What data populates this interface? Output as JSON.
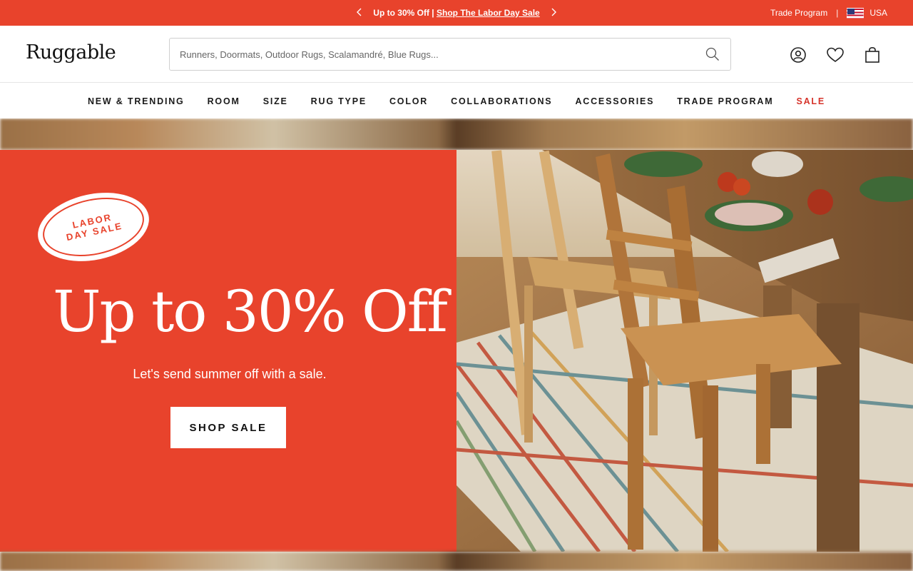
{
  "announcement": {
    "text": "Up to 30% Off |",
    "link_text": "Shop The Labor Day Sale",
    "prev_icon": "chevron-left-icon",
    "next_icon": "chevron-right-icon",
    "trade_program": "Trade Program",
    "separator": "|",
    "country": "USA",
    "flag_icon": "us-flag-icon"
  },
  "header": {
    "logo": "Ruggable",
    "search_placeholder": "Runners, Doormats, Outdoor Rugs, Scalamandré, Blue Rugs...",
    "icons": [
      "search-icon",
      "account-icon",
      "heart-icon",
      "cart-icon"
    ]
  },
  "nav": {
    "items": [
      {
        "label": "NEW & TRENDING"
      },
      {
        "label": "ROOM"
      },
      {
        "label": "SIZE"
      },
      {
        "label": "RUG TYPE"
      },
      {
        "label": "COLOR"
      },
      {
        "label": "COLLABORATIONS"
      },
      {
        "label": "ACCESSORIES"
      },
      {
        "label": "TRADE PROGRAM"
      },
      {
        "label": "SALE"
      }
    ]
  },
  "hero": {
    "badge_line1": "LABOR",
    "badge_line2": "DAY SALE",
    "headline": "Up to 30% Off",
    "subheadline": "Let's send summer off with a sale.",
    "cta": "SHOP SALE"
  },
  "colors": {
    "brand_red": "#e8432c",
    "sale_text": "#d6332a"
  }
}
